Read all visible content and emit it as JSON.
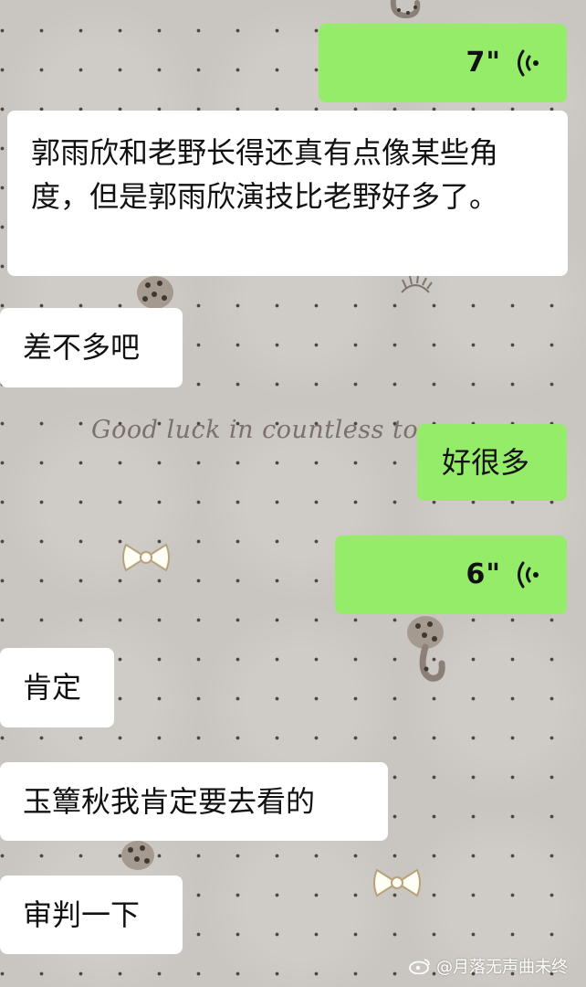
{
  "background": {
    "script_text": "Good luck in countless tomo"
  },
  "messages": [
    {
      "side": "right",
      "kind": "voice",
      "duration": "7\""
    },
    {
      "side": "left",
      "kind": "text",
      "text": "郭雨欣和老野长得还真有点像某些角度，但是郭雨欣演技比老野好多了。"
    },
    {
      "side": "left",
      "kind": "text",
      "text": "差不多吧"
    },
    {
      "side": "right",
      "kind": "text",
      "text": "好很多"
    },
    {
      "side": "right",
      "kind": "voice",
      "duration": "6\""
    },
    {
      "side": "left",
      "kind": "text",
      "text": "肯定"
    },
    {
      "side": "left",
      "kind": "text",
      "text": "玉簟秋我肯定要去看的"
    },
    {
      "side": "left",
      "kind": "text",
      "text": "审判一下"
    }
  ],
  "watermark": {
    "text": "@月落无声曲未终"
  },
  "colors": {
    "sent_bubble": "#95ec69",
    "received_bubble": "#ffffff",
    "background": "#c9c5c0"
  }
}
